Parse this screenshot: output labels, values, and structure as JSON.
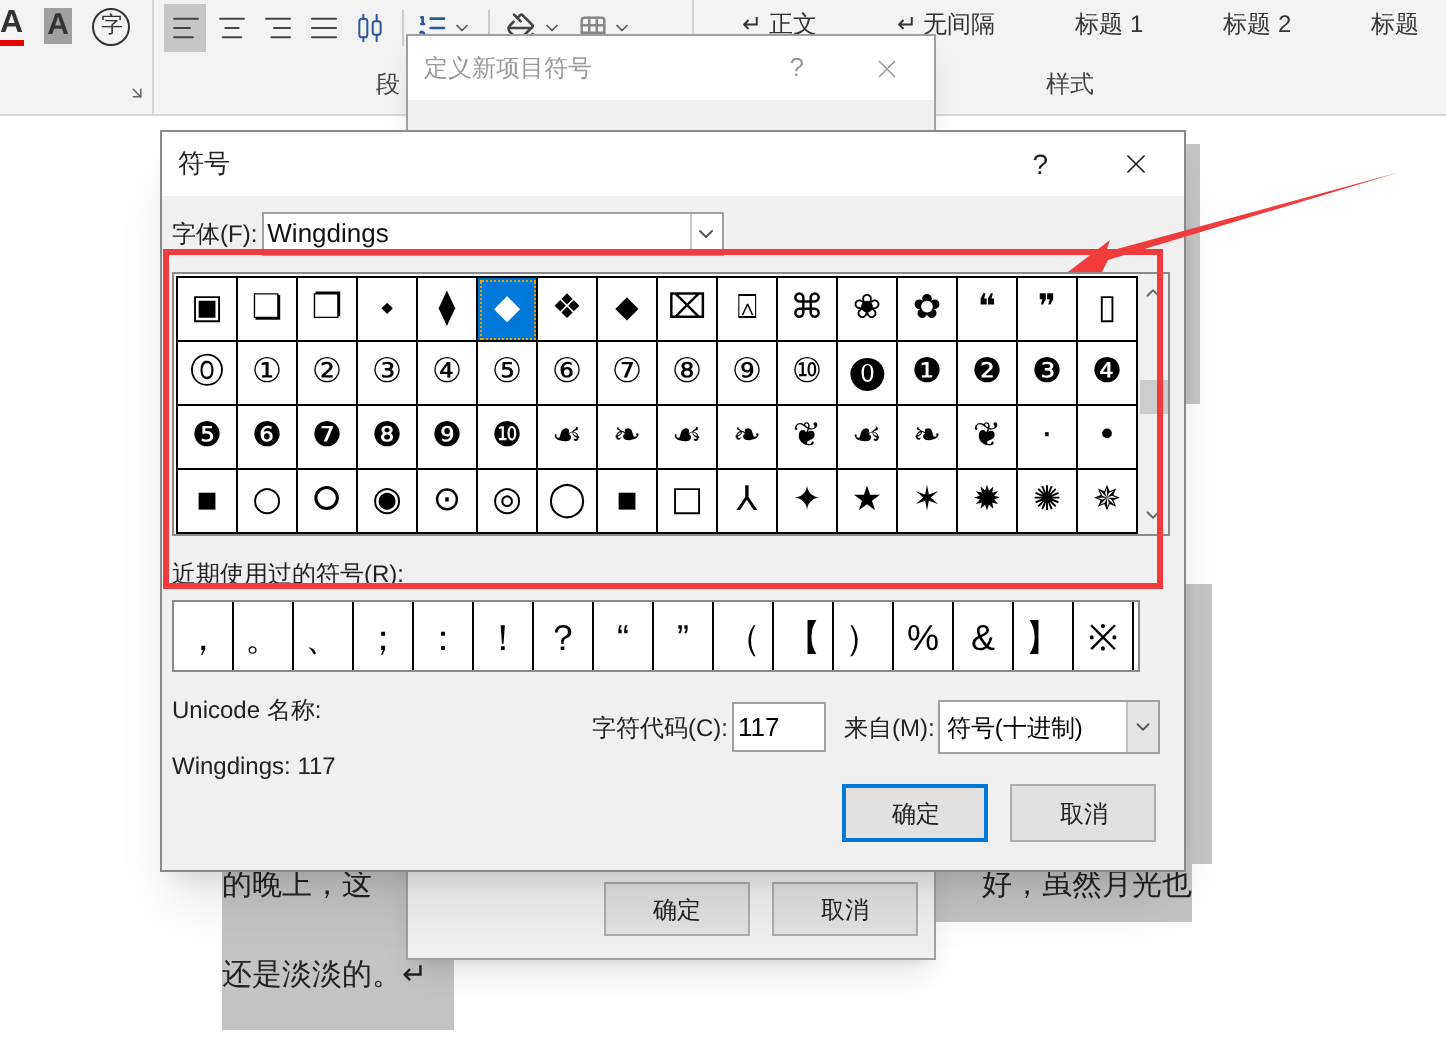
{
  "ribbon": {
    "font_glyphs": [
      {
        "kind": "font-color",
        "text": "A"
      },
      {
        "kind": "highlight",
        "text": "A"
      },
      {
        "kind": "enclose",
        "text": "字"
      }
    ],
    "align_buttons": [
      {
        "kind": "left",
        "selected": true
      },
      {
        "kind": "center",
        "selected": false
      },
      {
        "kind": "right",
        "selected": false
      },
      {
        "kind": "justify",
        "selected": false
      },
      {
        "kind": "distribute",
        "selected": false
      }
    ],
    "paragraph_group_label": "段",
    "styles": [
      {
        "label": "正文",
        "mark": "↵"
      },
      {
        "label": "无间隔",
        "mark": "↵"
      },
      {
        "label": "标题 1"
      },
      {
        "label": "标题 2"
      },
      {
        "label": "标题"
      }
    ],
    "styles_group_label": "样式"
  },
  "document": {
    "left_lines": [
      "的晚上，这",
      "还是淡淡的。↵"
    ],
    "right_line": "好，虽然月光也"
  },
  "back_dialog": {
    "title": "定义新项目符号",
    "help": "?",
    "buttons": [
      "确定",
      "取消"
    ]
  },
  "symbol_dialog": {
    "title": "符号",
    "help": "?",
    "font_label": "字体(F):",
    "font": "Wingdings",
    "symbols": [
      {
        "char": "▣",
        "selected": false
      },
      {
        "char": "❏",
        "selected": false
      },
      {
        "char": "❐",
        "selected": false
      },
      {
        "char": "⬩",
        "selected": false
      },
      {
        "char": "⧫",
        "selected": false
      },
      {
        "char": "◆",
        "selected": true
      },
      {
        "char": "❖",
        "selected": false
      },
      {
        "char": "⬥",
        "selected": false
      },
      {
        "char": "⌧",
        "selected": false
      },
      {
        "char": "⍓",
        "selected": false
      },
      {
        "char": "⌘",
        "selected": false
      },
      {
        "char": "❀",
        "selected": false
      },
      {
        "char": "✿",
        "selected": false
      },
      {
        "char": "❝",
        "selected": false
      },
      {
        "char": "❞",
        "selected": false
      },
      {
        "char": "▯",
        "selected": false
      },
      {
        "char": "⓪",
        "selected": false
      },
      {
        "char": "①",
        "selected": false
      },
      {
        "char": "②",
        "selected": false
      },
      {
        "char": "③",
        "selected": false
      },
      {
        "char": "④",
        "selected": false
      },
      {
        "char": "⑤",
        "selected": false
      },
      {
        "char": "⑥",
        "selected": false
      },
      {
        "char": "⑦",
        "selected": false
      },
      {
        "char": "⑧",
        "selected": false
      },
      {
        "char": "⑨",
        "selected": false
      },
      {
        "char": "⑩",
        "selected": false
      },
      {
        "char": "⓿",
        "selected": false
      },
      {
        "char": "❶",
        "selected": false
      },
      {
        "char": "❷",
        "selected": false
      },
      {
        "char": "❸",
        "selected": false
      },
      {
        "char": "❹",
        "selected": false
      },
      {
        "char": "❺",
        "selected": false
      },
      {
        "char": "❻",
        "selected": false
      },
      {
        "char": "❼",
        "selected": false
      },
      {
        "char": "❽",
        "selected": false
      },
      {
        "char": "❾",
        "selected": false
      },
      {
        "char": "❿",
        "selected": false
      },
      {
        "char": "☙",
        "selected": false
      },
      {
        "char": "❧",
        "selected": false
      },
      {
        "char": "☙",
        "selected": false
      },
      {
        "char": "❧",
        "selected": false
      },
      {
        "char": "❦",
        "selected": false
      },
      {
        "char": "☙",
        "selected": false
      },
      {
        "char": "❧",
        "selected": false
      },
      {
        "char": "❦",
        "selected": false
      },
      {
        "char": "·",
        "selected": false
      },
      {
        "char": "•",
        "selected": false
      },
      {
        "char": "▪",
        "selected": false
      },
      {
        "char": "○",
        "selected": false
      },
      {
        "char": "⭘",
        "selected": false
      },
      {
        "char": "◉",
        "selected": false
      },
      {
        "char": "⊙",
        "selected": false
      },
      {
        "char": "◎",
        "selected": false
      },
      {
        "char": "◯",
        "selected": false
      },
      {
        "char": "▪",
        "selected": false
      },
      {
        "char": "□",
        "selected": false
      },
      {
        "char": "⅄",
        "selected": false
      },
      {
        "char": "✦",
        "selected": false
      },
      {
        "char": "★",
        "selected": false
      },
      {
        "char": "✶",
        "selected": false
      },
      {
        "char": "✹",
        "selected": false
      },
      {
        "char": "✺",
        "selected": false
      },
      {
        "char": "✵",
        "selected": false
      }
    ],
    "recent_label": "近期使用过的符号(R):",
    "recent": [
      "，",
      "。",
      "、",
      "；",
      "：",
      "！",
      "？",
      "“",
      "”",
      "（",
      "【",
      "）",
      "%",
      "&",
      "】",
      "※"
    ],
    "unicode_name_label": "Unicode 名称:",
    "code_info": "Wingdings: 117",
    "char_code_label": "字符代码(C):",
    "char_code": "117",
    "from_label": "来自(M):",
    "from": "符号(十进制)",
    "buttons": [
      {
        "label": "确定",
        "default": true
      },
      {
        "label": "取消",
        "default": false
      }
    ]
  }
}
